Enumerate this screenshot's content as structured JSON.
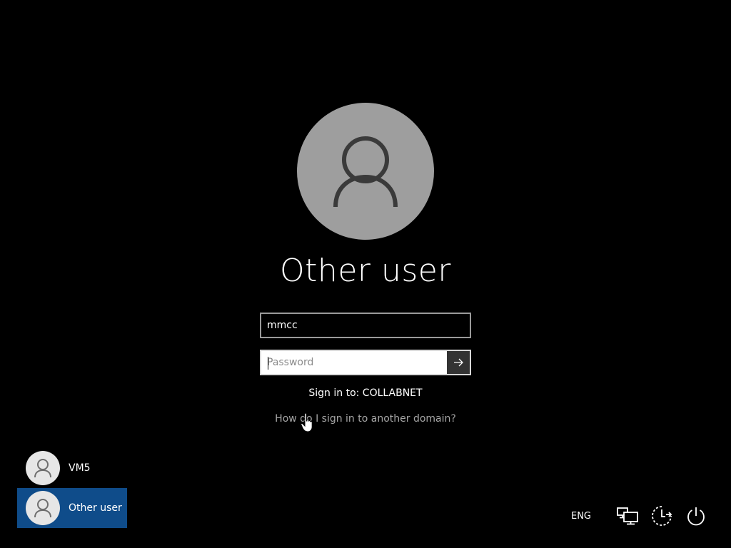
{
  "lock_screen": {
    "selected_user": "Other user",
    "username": {
      "value": "mmcc"
    },
    "password": {
      "placeholder": "Password"
    },
    "sign_in_to": "Sign in to: COLLABNET",
    "domain_help_link": "How do I sign in to another domain?",
    "users": [
      {
        "name": "VM5",
        "selected": false
      },
      {
        "name": "Other user",
        "selected": true
      }
    ],
    "tray": {
      "language": "ENG"
    },
    "icons": {
      "avatar": "person-icon",
      "submit": "arrow-right-icon",
      "network": "network-icon",
      "accessibility": "ease-of-access-icon",
      "power": "power-icon",
      "cursor": "hand-cursor-icon"
    },
    "colors": {
      "background": "#000000",
      "avatar_large": "#9e9e9e",
      "selected_tile": "#0f4c8a",
      "link": "#a6a6a6"
    }
  }
}
